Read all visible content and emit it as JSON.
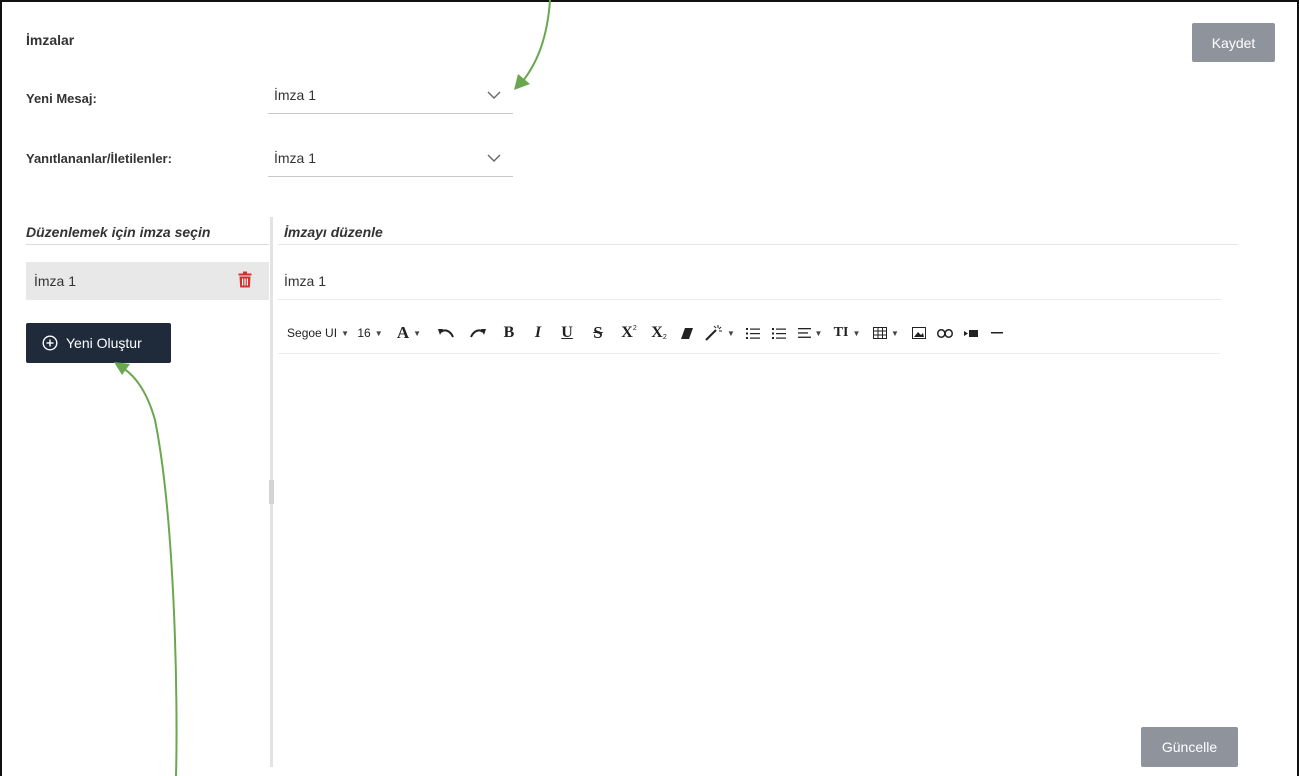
{
  "page": {
    "title": "İmzalar"
  },
  "actions": {
    "save_label": "Kaydet",
    "update_label": "Güncelle",
    "new_label": "Yeni Oluştur"
  },
  "defaults": {
    "new_message": {
      "label": "Yeni Mesaj:",
      "value": "İmza 1"
    },
    "replies_forwards": {
      "label": "Yanıtlananlar/İletilenler:",
      "value": "İmza 1"
    }
  },
  "signature_list": {
    "heading": "Düzenlemek için imza seçin",
    "items": [
      {
        "label": "İmza 1"
      }
    ]
  },
  "editor": {
    "heading": "İmzayı düzenle",
    "signature_name": "İmza 1",
    "toolbar": {
      "font_family": "Segoe UI",
      "font_size": "16",
      "font_color_letter": "A",
      "bold": "B",
      "italic": "I",
      "underline": "U",
      "strikethrough": "S",
      "superscript": "X",
      "subscript": "X",
      "line_height": "TI"
    }
  },
  "colors": {
    "dark_button": "#1f2a3b",
    "disabled_button": "#8f949c",
    "delete_icon": "#d32f2f",
    "annotation_arrow": "#6aa84f"
  }
}
